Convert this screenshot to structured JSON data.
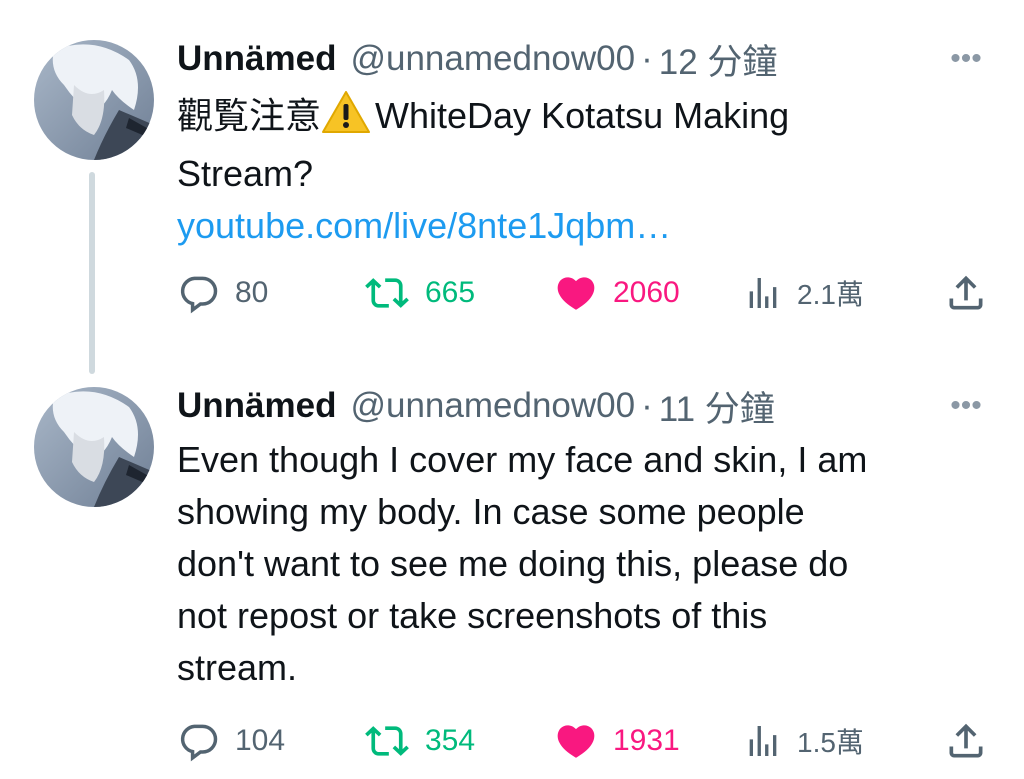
{
  "tweets": [
    {
      "author": {
        "name": "Unnämed",
        "handle": "@unnamednow00",
        "separator": "·",
        "time": "12 分鐘"
      },
      "body_lines": [
        "觀覧注意",
        "WhiteDay Kotatsu Making",
        "Stream?"
      ],
      "link": "youtube.com/live/8nte1Jqbm…",
      "stats": {
        "replies": "80",
        "reposts": "665",
        "likes": "2060",
        "views": "2.1萬"
      },
      "more_label": "•••"
    },
    {
      "author": {
        "name": "Unnämed",
        "handle": "@unnamednow00",
        "separator": "·",
        "time": "11 分鐘"
      },
      "body_lines": [
        "Even though I cover my face and skin, I am",
        "showing my body. In case some people",
        "don't want to see me doing this, please do",
        "not repost or take screenshots of this",
        "stream."
      ],
      "stats": {
        "replies": "104",
        "reposts": "354",
        "likes": "1931",
        "views": "1.5萬"
      },
      "more_label": "•••"
    }
  ],
  "icons": {
    "warning": "warning-emoji-icon",
    "reply": "reply-icon",
    "repost": "repost-icon",
    "like": "heart-icon",
    "views": "views-icon",
    "share": "share-icon"
  },
  "colors": {
    "text": "#0f1419",
    "secondary": "#536471",
    "link": "#1d9bf0",
    "repost": "#00ba7c",
    "like": "#f91880",
    "thread_line": "#cfd9de"
  }
}
